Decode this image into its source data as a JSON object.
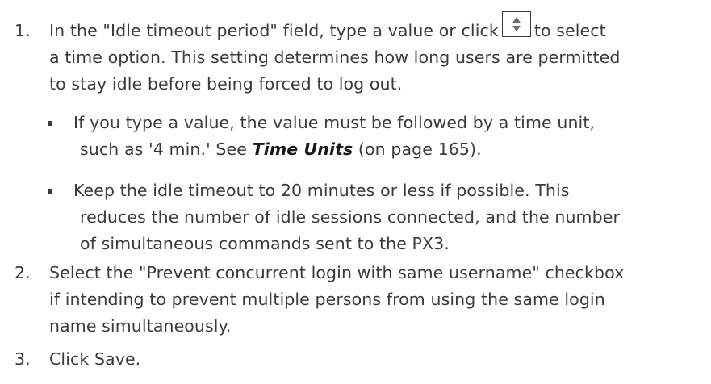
{
  "steps": [
    {
      "number": "1.",
      "line1_before": "In the \"Idle timeout period\" field, type a value or click",
      "line1_after": "to select",
      "icon": "spinner-up-down-icon",
      "line2": "a time option. This setting determines how long users are permitted",
      "line3": "to stay idle before being forced to log out.",
      "bullets": [
        {
          "line1": "If you type a value, the value must be followed by a time unit,",
          "line2_before": "such as '4 min.' See",
          "link": "Time Units",
          "line2_after": "(on page 165)."
        },
        {
          "line1": "Keep the idle timeout to 20 minutes or less if possible. This",
          "line2": "reduces the number of idle sessions connected, and the number",
          "line3": "of simultaneous commands sent to the PX3."
        }
      ]
    },
    {
      "number": "2.",
      "line1": "Select the \"Prevent concurrent login with same username\" checkbox",
      "line2": "if intending to prevent multiple persons from using the same login",
      "line3": "name simultaneously."
    },
    {
      "number": "3.",
      "line1": "Click Save."
    }
  ]
}
